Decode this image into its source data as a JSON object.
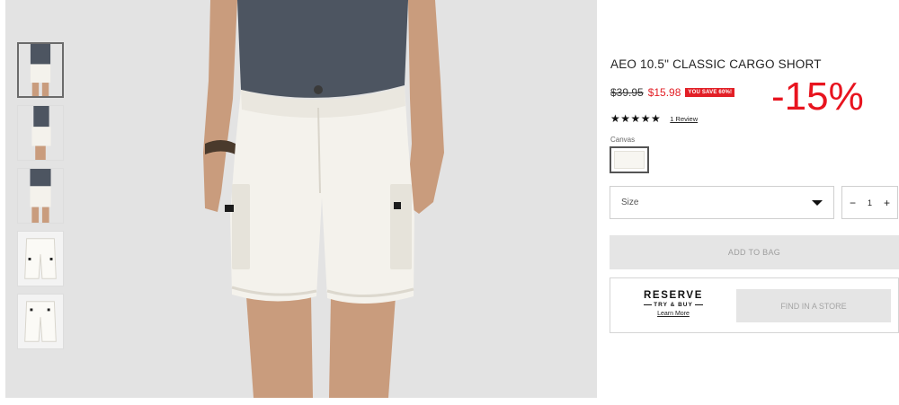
{
  "product": {
    "title": "AEO 10.5\" CLASSIC CARGO SHORT",
    "old_price": "$39.95",
    "new_price": "$15.98",
    "save_badge": "YOU SAVE 60%!",
    "discount_overlay": "-15%",
    "rating_stars": "★★★★★",
    "rating_value": 5,
    "review_link": "1 Review",
    "color_label": "Canvas",
    "colors": {
      "accent_red": "#e21f26",
      "swatch_canvas": "#f7f6f1"
    }
  },
  "size_select": {
    "label": "Size",
    "icon": "caret-down-icon"
  },
  "quantity": {
    "minus": "−",
    "value": "1",
    "plus": "+"
  },
  "add_to_bag_label": "ADD TO BAG",
  "reserve": {
    "logo_top": "RESERVE",
    "logo_bottom": "TRY & BUY",
    "learn_more": "Learn More",
    "find_store_label": "FIND IN A STORE"
  },
  "gallery": {
    "thumbnails": [
      "front-view",
      "side-view",
      "back-view",
      "flat-lay-front",
      "flat-lay-back"
    ],
    "active_thumbnail": 0
  }
}
